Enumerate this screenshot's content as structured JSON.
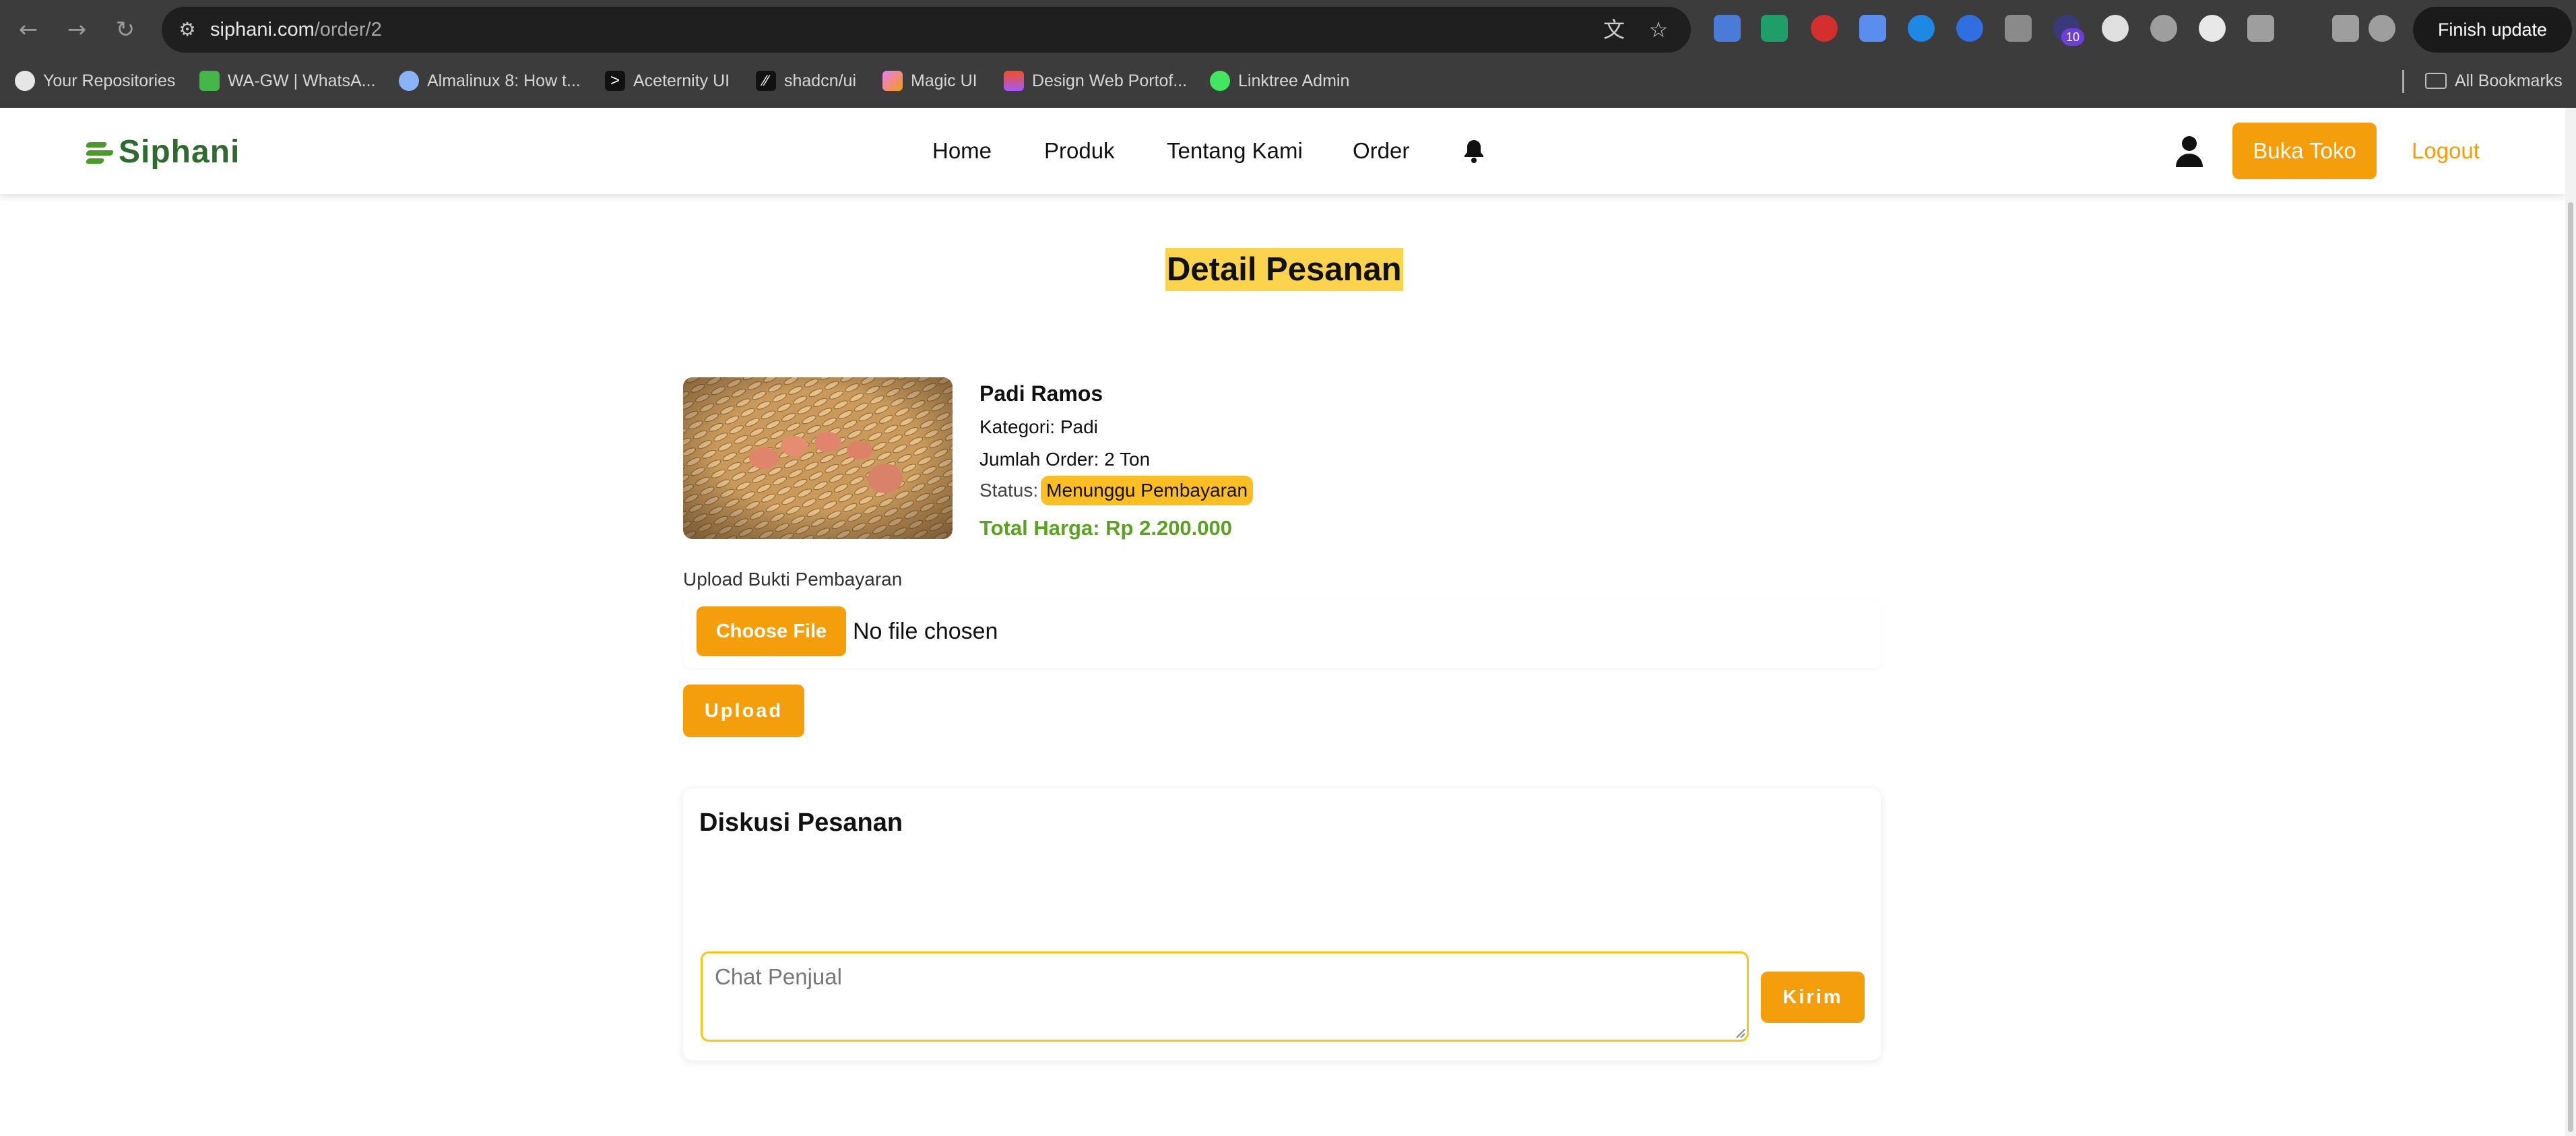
{
  "browser": {
    "url_host": "siphani.com",
    "url_path": "/order/2",
    "extension_badge": "10",
    "finish_update_label": "Finish update",
    "all_bookmarks_label": "All Bookmarks",
    "bookmarks": [
      {
        "label": "Your Repositories",
        "icon": "github-icon",
        "color": "#e6e6e6"
      },
      {
        "label": "WA-GW | WhatsA...",
        "icon": "whatsapp-gw-icon",
        "color": "#45b649"
      },
      {
        "label": "Almalinux 8: How t...",
        "icon": "globe-icon",
        "color": "#8ab4f8"
      },
      {
        "label": "Aceternity UI",
        "icon": "aceternity-icon",
        "color": "#111111"
      },
      {
        "label": "shadcn/ui",
        "icon": "shadcn-icon",
        "color": "#111111"
      },
      {
        "label": "Magic UI",
        "icon": "magic-ui-icon",
        "color": "#e879f9"
      },
      {
        "label": "Design Web Portof...",
        "icon": "figma-icon",
        "color": "#f24e1e"
      },
      {
        "label": "Linktree Admin",
        "icon": "linktree-icon",
        "color": "#43e660"
      }
    ]
  },
  "site": {
    "logo_text": "Siphani",
    "nav": [
      "Home",
      "Produk",
      "Tentang Kami",
      "Order"
    ],
    "buka_toko_label": "Buka Toko",
    "logout_label": "Logout",
    "accent_color": "#f59e0b"
  },
  "order": {
    "page_title": "Detail Pesanan",
    "product_name": "Padi Ramos",
    "kategori_text": "Kategori: Padi",
    "jumlah_text": "Jumlah Order: 2 Ton",
    "status_label": "Status:",
    "status_value": "Menunggu Pembayaran",
    "total_text": "Total Harga: Rp 2.200.000",
    "upload_label": "Upload Bukti Pembayaran",
    "choose_file_label": "Choose File",
    "no_file_text": "No file chosen",
    "upload_button": "Upload"
  },
  "chat": {
    "title": "Diskusi Pesanan",
    "placeholder": "Chat Penjual",
    "send_label": "Kirim"
  }
}
